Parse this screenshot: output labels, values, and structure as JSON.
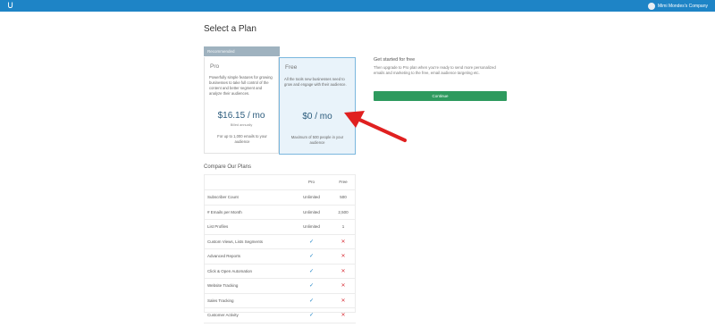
{
  "header": {
    "logo_glyph": "ᑌ",
    "account_name": "Mimi Mondes's Company"
  },
  "page_title": "Select a Plan",
  "plans": {
    "recommended_label": "Recommended",
    "pro": {
      "name": "Pro",
      "description": "Powerfully simple features for growing businesses to take full control of the content and better segment and analyze their audiences.",
      "price": "$16.15 / mo",
      "note": "Billed annually",
      "footer": "For up to 1,000 emails to your audience"
    },
    "free": {
      "name": "Free",
      "description": "All the tools new businesses need to grow and engage with their audience.",
      "price": "$0 / mo",
      "footer": "Maximum of 500 people in your audience"
    }
  },
  "get_started": {
    "title": "Get started for free",
    "text": "Then upgrade to Pro plan when you're ready to send more personalized emails and marketing to the free, email audience targeting etc.",
    "button": "Continue"
  },
  "compare": {
    "title": "Compare Our Plans",
    "columns": [
      "",
      "Pro",
      "Free"
    ],
    "rows": [
      {
        "feature": "Subscriber Count",
        "pro": "Unlimited",
        "free": "500"
      },
      {
        "feature": "# Emails per Month",
        "pro": "Unlimited",
        "free": "2,500"
      },
      {
        "feature": "List Profiles",
        "pro": "Unlimited",
        "free": "1"
      },
      {
        "feature": "Custom Views, Lists Segments",
        "pro": "check",
        "free": "cross"
      },
      {
        "feature": "Advanced Reports",
        "pro": "check",
        "free": "cross"
      },
      {
        "feature": "Click & Open Automation",
        "pro": "check",
        "free": "cross"
      },
      {
        "feature": "Website Tracking",
        "pro": "check",
        "free": "cross"
      },
      {
        "feature": "Sales Tracking",
        "pro": "check",
        "free": "cross"
      },
      {
        "feature": "Customer Activity",
        "pro": "check",
        "free": "cross"
      }
    ]
  },
  "colors": {
    "brand": "#1e84c6",
    "continue": "#2e9a5e",
    "check": "#1e84c6",
    "cross": "#d9363e",
    "arrow": "#e02020"
  },
  "icons": {
    "check": "✓",
    "cross": "✕"
  }
}
